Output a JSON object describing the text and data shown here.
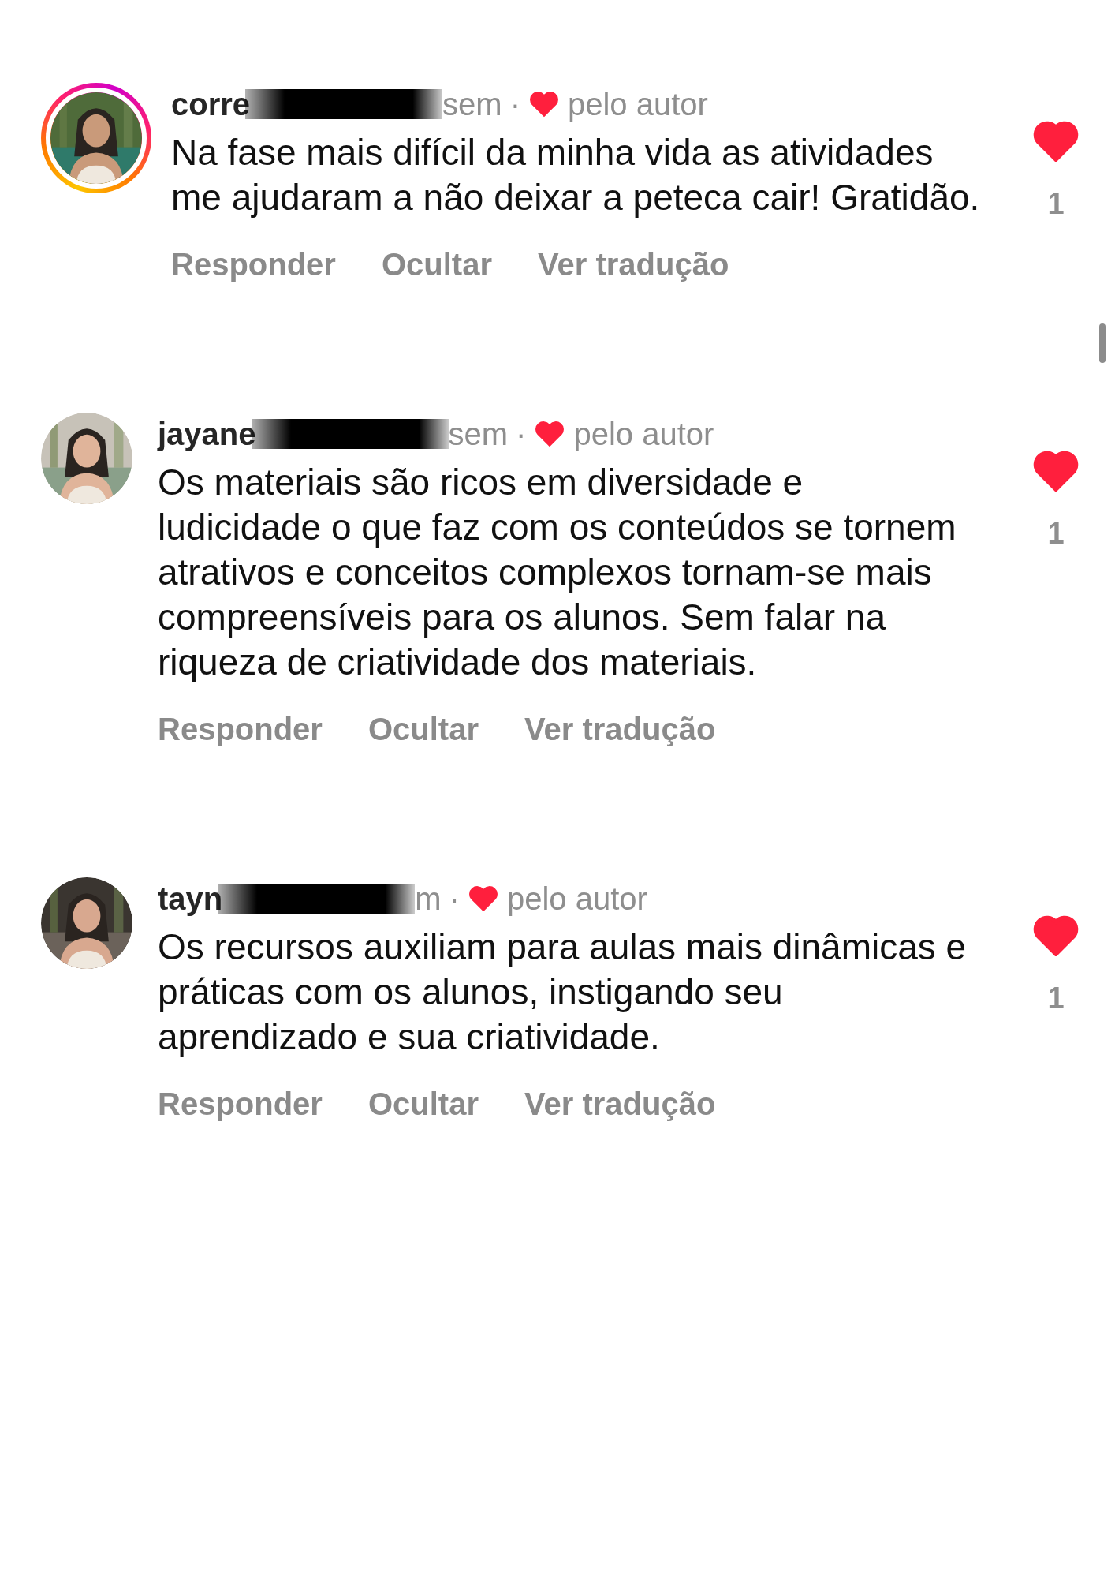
{
  "comments": [
    {
      "username": "corre",
      "time": "sem",
      "separator": "·",
      "story_ring": true,
      "author_liked": true,
      "author_label": "pelo autor",
      "text": "Na fase mais difícil da minha vida as atividades me ajudaram a não deixar a peteca cair! Gratidão.",
      "actions": [
        "Responder",
        "Ocultar",
        "Ver tradução"
      ],
      "liked": true,
      "like_count": "1"
    },
    {
      "username": "jayane",
      "time": "sem",
      "separator": "·",
      "story_ring": false,
      "author_liked": true,
      "author_label": "pelo autor",
      "text": "Os materiais são ricos em diversidade e ludicidade o que faz com os conteúdos se tornem atrativos e conceitos complexos tornam-se mais compreensíveis para os alunos. Sem falar na riqueza de criatividade dos materiais.",
      "actions": [
        "Responder",
        "Ocultar",
        "Ver tradução"
      ],
      "liked": true,
      "like_count": "1"
    },
    {
      "username": "tayn",
      "time": "m",
      "separator": "·",
      "story_ring": false,
      "author_liked": true,
      "author_label": "pelo autor",
      "text": "Os recursos auxiliam para aulas mais dinâmicas e práticas com os alunos, instigando seu aprendizado e sua criatividade.",
      "actions": [
        "Responder",
        "Ocultar",
        "Ver tradução"
      ],
      "liked": true,
      "like_count": "1"
    }
  ]
}
